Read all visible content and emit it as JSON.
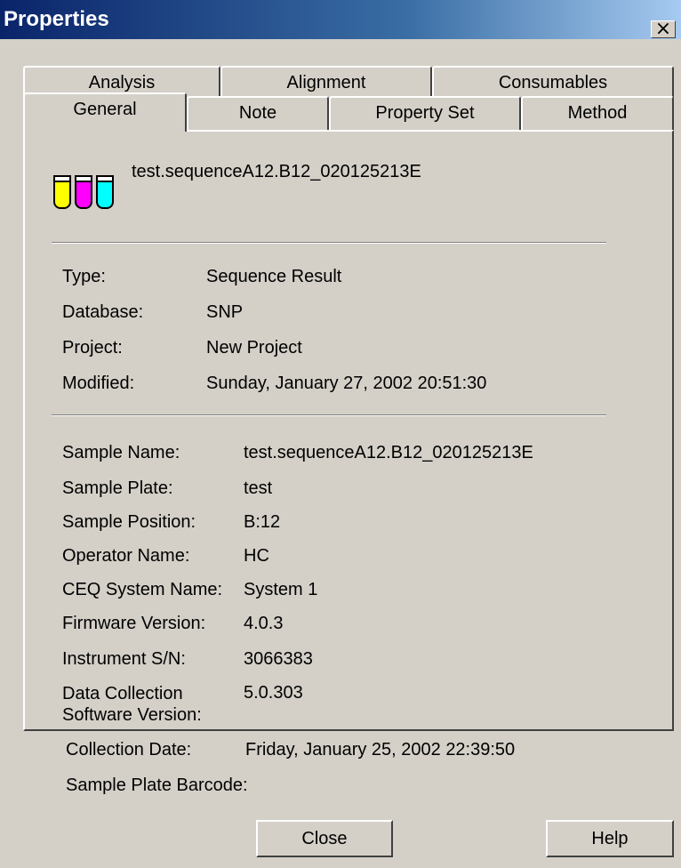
{
  "window": {
    "title": "Properties",
    "close_glyph": "×"
  },
  "tabs": {
    "row1": [
      "Analysis",
      "Alignment",
      "Consumables"
    ],
    "row2": [
      "General",
      "Note",
      "Property Set",
      "Method"
    ],
    "active": "General"
  },
  "header": {
    "icon": "test-tubes-icon",
    "file_name": "test.sequenceA12.B12_020125213E"
  },
  "general": [
    {
      "label": "Type:",
      "value": "Sequence Result"
    },
    {
      "label": "Database:",
      "value": "SNP"
    },
    {
      "label": "Project:",
      "value": "New Project"
    },
    {
      "label": "Modified:",
      "value": "Sunday, January 27, 2002 20:51:30"
    }
  ],
  "sample": [
    {
      "label": "Sample Name:",
      "value": "test.sequenceA12.B12_020125213E"
    },
    {
      "label": "Sample Plate:",
      "value": "test"
    },
    {
      "label": "Sample Position:",
      "value": "B:12"
    },
    {
      "label": "Operator Name:",
      "value": "HC"
    },
    {
      "label": "CEQ System Name:",
      "value": "System 1"
    },
    {
      "label": "Firmware Version:",
      "value": "4.0.3"
    },
    {
      "label": "Instrument S/N:",
      "value": "3066383"
    },
    {
      "label": "Data Collection Software Version:",
      "value": "5.0.303"
    },
    {
      "label": "Collection Date:",
      "value": "Friday, January 25, 2002 22:39:50"
    },
    {
      "label": "Sample Plate Barcode:",
      "value": ""
    }
  ],
  "buttons": {
    "close": "Close",
    "help": "Help"
  },
  "colors": {
    "title_bar_start": "#0a246a",
    "title_bar_end": "#a6caf0",
    "dialog_face": "#d4d0c8",
    "tube_yellow": "#ffff00",
    "tube_magenta": "#ff00ff",
    "tube_cyan": "#00ffff"
  }
}
